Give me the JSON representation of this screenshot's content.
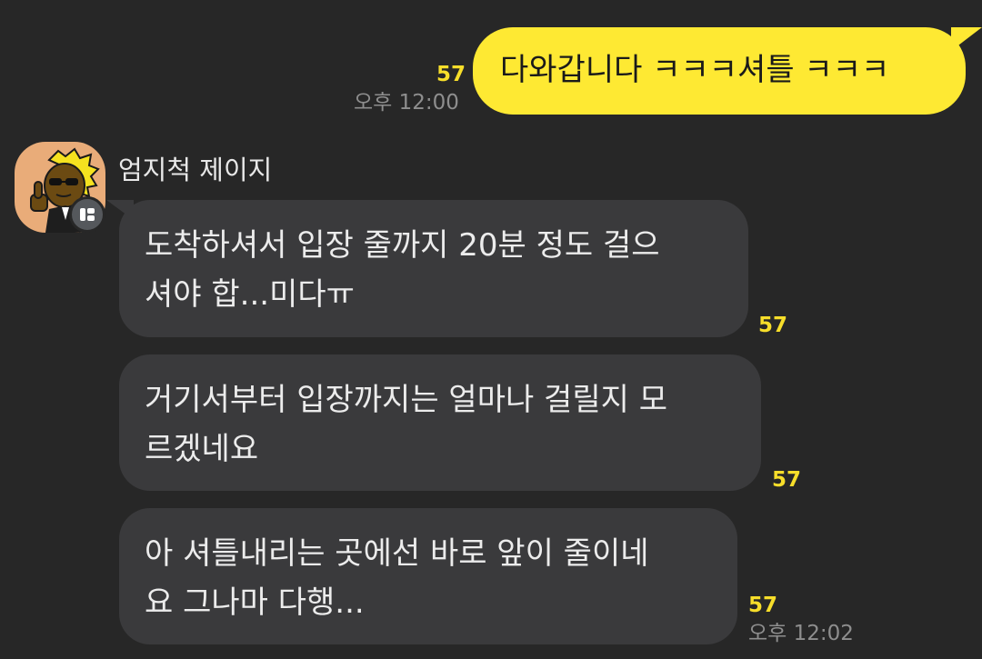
{
  "sent_message": {
    "text": "다와갑니다 ㅋㅋㅋ셔틀 ㅋㅋㅋ",
    "unread_count": "57",
    "time": "오후 12:00"
  },
  "sender": {
    "name": "엄지척 제이지",
    "avatar_icon": "thumbs-up-character-icon",
    "badge_icon": "profile-badge-icon"
  },
  "received_messages": [
    {
      "lines": [
        "도착하셔서 입장 줄까지 20분 정도 걸으",
        "셔야 합...미다ㅠ"
      ],
      "unread_count": "57"
    },
    {
      "lines": [
        "거기서부터 입장까지는 얼마나 걸릴지 모",
        "르겠네요"
      ],
      "unread_count": "57"
    },
    {
      "lines": [
        "아 셔틀내리는 곳에선 바로 앞이 줄이네",
        "요 그나마 다행..."
      ],
      "unread_count": "57",
      "time": "오후 12:02"
    }
  ],
  "colors": {
    "background": "#272727",
    "sent_bubble": "#fee933",
    "received_bubble": "#3a3a3c",
    "unread": "#f7de2a",
    "time": "#8e8e8e"
  }
}
